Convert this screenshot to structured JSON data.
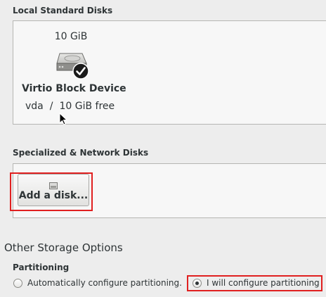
{
  "local_disks": {
    "section_label": "Local Standard Disks",
    "disk": {
      "size": "10 GiB",
      "name": "Virtio Block Device",
      "device": "vda",
      "separator": "/",
      "free": "10 GiB free",
      "selected": true
    }
  },
  "network_disks": {
    "section_label": "Specialized & Network Disks",
    "add_button_label": "Add a disk..."
  },
  "other_options": {
    "heading": "Other Storage Options",
    "partitioning_label": "Partitioning",
    "auto_option_label": "Automatically configure partitioning.",
    "manual_option_label": "I will configure partitioning",
    "selected_option": "manual"
  },
  "colors": {
    "highlight": "#e02020",
    "panel_bg": "#f7f7f7",
    "window_bg": "#ededed"
  }
}
